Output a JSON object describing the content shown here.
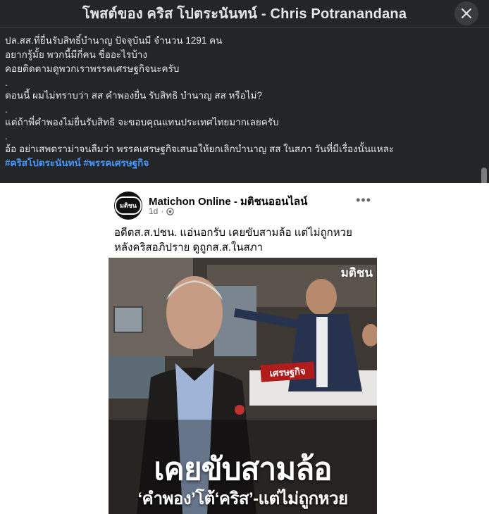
{
  "dialog": {
    "title": "โพสต์ของ คริส โปตระนันทน์ - Chris Potranandana",
    "close_icon": "close-icon"
  },
  "post": {
    "lines": [
      "ปล.สส.ที่ยื่นรับสิทธิ์บำนาญ ปัจจุบันมี จำนวน 1291 คน",
      "อยากรู้มั้ย พวกนี้มีกี่คน ชื่ออะไรบ้าง",
      "คอยติดตามดูพวกเราพรรคเศรษฐกิจนะครับ",
      ".",
      "ตอนนี้ ผมไม่ทราบว่า สส คำพองยื่น รับสิทธิ บำนาญ สส หรือไม่?",
      ".",
      "แต่ถ้าพี่คำพองไม่ยื่นรับสิทธิ จะขอบคุณแทนประเทศไทยมากเลยครับ",
      ".",
      "อ้อ อย่าเสพดราม่าจนลืมว่า พรรคเศรษฐกิจเสนอให้ยกเลิกบำนาญ สส ในสภา วันที่มีเรื่องนั้นแหละ"
    ],
    "hashtags": "#คริสโปตระนันทน์ #พรรคเศรษฐกิจ"
  },
  "shared_card": {
    "page_name": "Matichon Online - มติชนออนไลน์",
    "avatar_text": "มติชน",
    "time": "1d",
    "audience_icon": "globe-icon",
    "more_icon": "more-dots-icon",
    "caption_line1": "อดีตส.ส.ปชน. แอ่นอกรับ เคยขับสามล้อ แต่ไม่ถูกหวย",
    "caption_line2": "หลังคริสอภิปราย ดูถูกส.ส.ในสภา",
    "photo": {
      "watermark": "มติชน",
      "sign_text": "เศรษฐกิจ",
      "headline_main": "เคยขับสามล้อ",
      "headline_sub": "‘คำพอง’โต้‘คริส’-แต่ไม่ถูกหวย"
    }
  },
  "colors": {
    "background": "#242526",
    "text": "#e4e6eb",
    "hashtag": "#4599ff"
  }
}
